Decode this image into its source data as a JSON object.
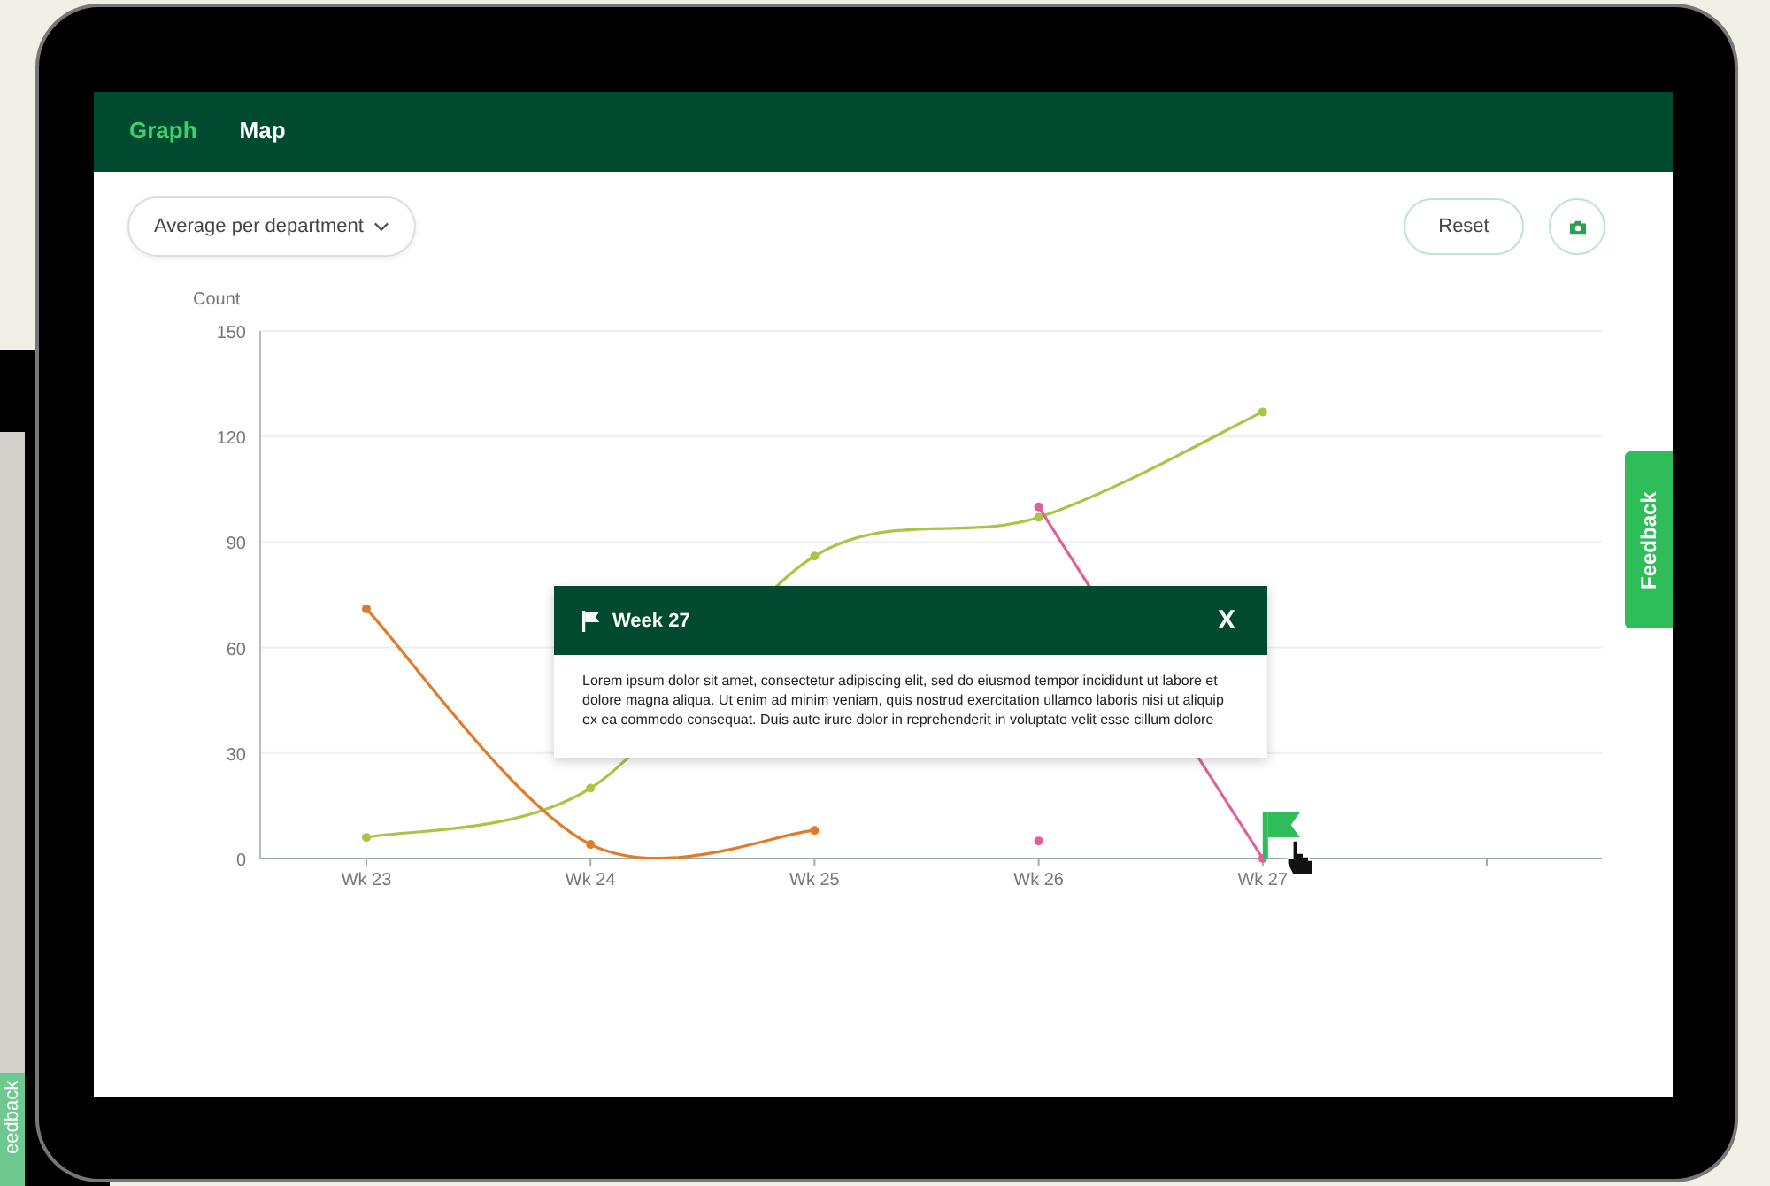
{
  "tabs": [
    {
      "label": "Graph",
      "selected": true
    },
    {
      "label": "Map",
      "selected": false
    }
  ],
  "dropdown": {
    "value": "Average per department"
  },
  "reset_button": "Reset",
  "chart_data": {
    "type": "line",
    "ylabel": "Count",
    "categories": [
      "Wk 23",
      "Wk 24",
      "Wk 25",
      "Wk 26",
      "Wk 27",
      null
    ],
    "grid": true,
    "ylim": [
      0,
      150
    ],
    "yticks": [
      0,
      30,
      60,
      90,
      120,
      150
    ],
    "series": [
      {
        "color": "#a8c545",
        "marker": "circle",
        "values": [
          6,
          20,
          86,
          97,
          127,
          null
        ]
      },
      {
        "color": "#e07b2a",
        "marker": "circle",
        "values": [
          71,
          4,
          8,
          null,
          null,
          null
        ]
      },
      {
        "color": "#e0609a",
        "marker": "circle",
        "values": [
          null,
          null,
          null,
          100,
          0,
          null
        ]
      },
      {
        "color": "#e0609a",
        "marker": "circle",
        "values": [
          null,
          null,
          null,
          5,
          null,
          null
        ]
      }
    ],
    "annotations": [
      {
        "x": "Wk 27"
      }
    ]
  },
  "popup": {
    "title": "Week 27",
    "close": "X",
    "text": "Lorem ipsum dolor sit amet, consectetur adipiscing elit, sed do eiusmod tempor incididunt ut labore et dolore magna aliqua. Ut enim ad minim veniam, quis nostrud exercitation ullamco laboris nisi ut aliquip ex ea commodo consequat. Duis aute irure dolor in reprehenderit in voluptate velit esse cillum dolore"
  },
  "feedback_tab": "Feedback",
  "tablet": {
    "feedback_tab": "eedback"
  }
}
